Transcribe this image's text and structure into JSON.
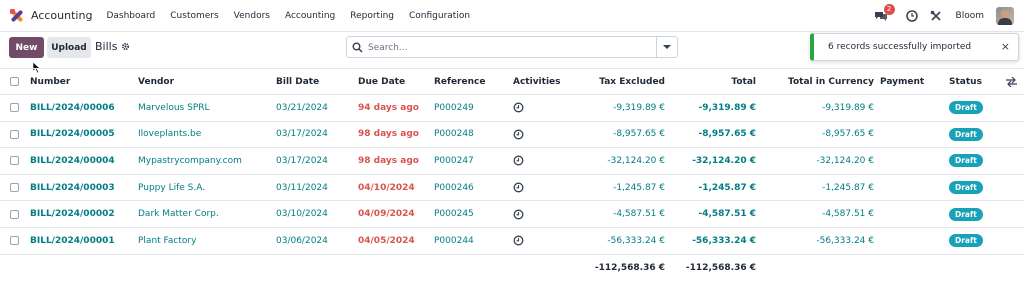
{
  "app": {
    "name": "Accounting"
  },
  "menu": [
    "Dashboard",
    "Customers",
    "Vendors",
    "Accounting",
    "Reporting",
    "Configuration"
  ],
  "topbar": {
    "chat_count": "2",
    "user": "Bloom"
  },
  "toolbar": {
    "new_label": "New",
    "upload_label": "Upload",
    "breadcrumb": "Bills"
  },
  "search": {
    "placeholder": "Search..."
  },
  "toast": {
    "message": "6 records successfully imported",
    "close": "×"
  },
  "table": {
    "headers": {
      "number": "Number",
      "vendor": "Vendor",
      "bill_date": "Bill Date",
      "due_date": "Due Date",
      "reference": "Reference",
      "activities": "Activities",
      "tax_excluded": "Tax Excluded",
      "total": "Total",
      "total_in_currency": "Total in Currency",
      "payment": "Payment",
      "status": "Status"
    },
    "rows": [
      {
        "number": "BILL/2024/00006",
        "vendor": "Marvelous SPRL",
        "bill_date": "03/21/2024",
        "due_date": "94 days ago",
        "reference": "P000249",
        "tax_excluded": "-9,319.89 €",
        "total": "-9,319.89 €",
        "total_in_currency": "-9,319.89 €",
        "status": "Draft"
      },
      {
        "number": "BILL/2024/00005",
        "vendor": "Iloveplants.be",
        "bill_date": "03/17/2024",
        "due_date": "98 days ago",
        "reference": "P000248",
        "tax_excluded": "-8,957.65 €",
        "total": "-8,957.65 €",
        "total_in_currency": "-8,957.65 €",
        "status": "Draft"
      },
      {
        "number": "BILL/2024/00004",
        "vendor": "Mypastrycompany.com",
        "bill_date": "03/17/2024",
        "due_date": "98 days ago",
        "reference": "P000247",
        "tax_excluded": "-32,124.20 €",
        "total": "-32,124.20 €",
        "total_in_currency": "-32,124.20 €",
        "status": "Draft"
      },
      {
        "number": "BILL/2024/00003",
        "vendor": "Puppy Life S.A.",
        "bill_date": "03/11/2024",
        "due_date": "04/10/2024",
        "reference": "P000246",
        "tax_excluded": "-1,245.87 €",
        "total": "-1,245.87 €",
        "total_in_currency": "-1,245.87 €",
        "status": "Draft"
      },
      {
        "number": "BILL/2024/00002",
        "vendor": "Dark Matter Corp.",
        "bill_date": "03/10/2024",
        "due_date": "04/09/2024",
        "reference": "P000245",
        "tax_excluded": "-4,587.51 €",
        "total": "-4,587.51 €",
        "total_in_currency": "-4,587.51 €",
        "status": "Draft"
      },
      {
        "number": "BILL/2024/00001",
        "vendor": "Plant Factory",
        "bill_date": "03/06/2024",
        "due_date": "04/05/2024",
        "reference": "P000244",
        "tax_excluded": "-56,333.24 €",
        "total": "-56,333.24 €",
        "total_in_currency": "-56,333.24 €",
        "status": "Draft"
      }
    ],
    "totals": {
      "tax_excluded": "-112,568.36 €",
      "total": "-112,568.36 €"
    }
  },
  "colors": {
    "brand": "#714b67",
    "link": "#017e84",
    "overdue": "#d9534f",
    "status_draft": "#17a2b8",
    "toast_success": "#28a745"
  },
  "icons": [
    "chat-icon",
    "clock-icon",
    "tools-icon",
    "gear-icon",
    "search-icon",
    "activity-clock-icon",
    "column-settings-icon"
  ]
}
